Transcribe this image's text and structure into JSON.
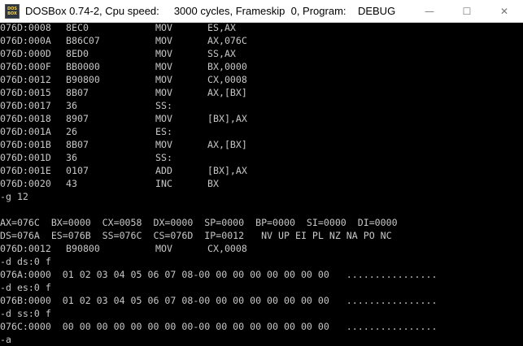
{
  "window": {
    "title": "DOSBox 0.74-2, Cpu speed:     3000 cycles, Frameskip  0, Program:    DEBUG",
    "icon_text_top": "DOS",
    "icon_text_bottom": "BOX",
    "minimize": "—",
    "maximize": "☐",
    "close": "✕"
  },
  "colors": {
    "terminal_bg": "#000000",
    "terminal_fg": "#c8c8c8"
  },
  "console": {
    "disasm": [
      {
        "addr": "076D:0008",
        "bytes": "8EC0",
        "op": "MOV",
        "args": "ES,AX"
      },
      {
        "addr": "076D:000A",
        "bytes": "B86C07",
        "op": "MOV",
        "args": "AX,076C"
      },
      {
        "addr": "076D:000D",
        "bytes": "8ED0",
        "op": "MOV",
        "args": "SS,AX"
      },
      {
        "addr": "076D:000F",
        "bytes": "BB0000",
        "op": "MOV",
        "args": "BX,0000"
      },
      {
        "addr": "076D:0012",
        "bytes": "B90800",
        "op": "MOV",
        "args": "CX,0008"
      },
      {
        "addr": "076D:0015",
        "bytes": "8B07",
        "op": "MOV",
        "args": "AX,[BX]"
      },
      {
        "addr": "076D:0017",
        "bytes": "36",
        "op": "SS:",
        "args": ""
      },
      {
        "addr": "076D:0018",
        "bytes": "8907",
        "op": "MOV",
        "args": "[BX],AX"
      },
      {
        "addr": "076D:001A",
        "bytes": "26",
        "op": "ES:",
        "args": ""
      },
      {
        "addr": "076D:001B",
        "bytes": "8B07",
        "op": "MOV",
        "args": "AX,[BX]"
      },
      {
        "addr": "076D:001D",
        "bytes": "36",
        "op": "SS:",
        "args": ""
      },
      {
        "addr": "076D:001E",
        "bytes": "0107",
        "op": "ADD",
        "args": "[BX],AX"
      },
      {
        "addr": "076D:0020",
        "bytes": "43",
        "op": "INC",
        "args": "BX"
      }
    ],
    "cmd_g": "-g 12",
    "regs1": "AX=076C  BX=0000  CX=0058  DX=0000  SP=0000  BP=0000  SI=0000  DI=0000",
    "regs2": "DS=076A  ES=076B  SS=076C  CS=076D  IP=0012   NV UP EI PL NZ NA PO NC",
    "cur_instr": {
      "addr": "076D:0012",
      "bytes": "B90800",
      "op": "MOV",
      "args": "CX,0008"
    },
    "cmd_d_ds": "-d ds:0 f",
    "dump_ds": "076A:0000  01 02 03 04 05 06 07 08-00 00 00 00 00 00 00 00   ................",
    "cmd_d_es": "-d es:0 f",
    "dump_es": "076B:0000  01 02 03 04 05 06 07 08-00 00 00 00 00 00 00 00   ................",
    "cmd_d_ss": "-d ss:0 f",
    "dump_ss": "076C:0000  00 00 00 00 00 00 00 00-00 00 00 00 00 00 00 00   ................",
    "cmd_a": "-a"
  }
}
